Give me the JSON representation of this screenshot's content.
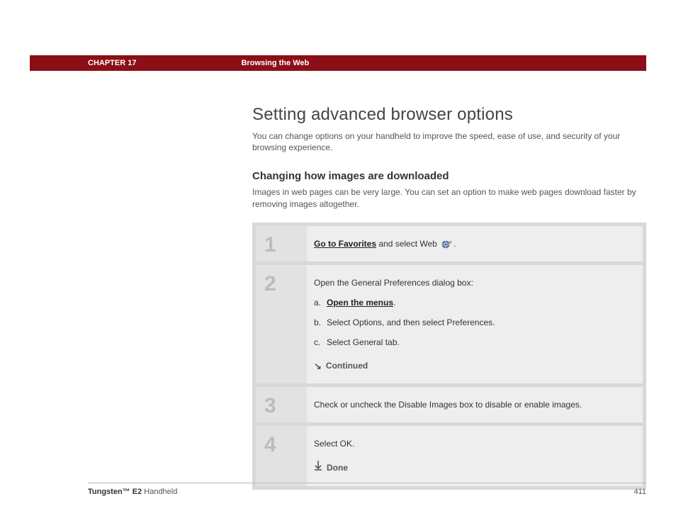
{
  "header": {
    "chapter": "CHAPTER 17",
    "title": "Browsing the Web"
  },
  "main": {
    "h1": "Setting advanced browser options",
    "intro": "You can change options on your handheld to improve the speed, ease of use, and security of your browsing experience.",
    "h2": "Changing how images are downloaded",
    "sub_intro": "Images in web pages can be very large. You can set an option to make web pages download faster by removing images altogether."
  },
  "steps": [
    {
      "num": "1",
      "link_text": "Go to Favorites",
      "after_link": " and select Web ",
      "trailing": "."
    },
    {
      "num": "2",
      "lead": "Open the General Preferences dialog box:",
      "substeps": [
        {
          "label": "a.",
          "link": "Open the menus",
          "tail": "."
        },
        {
          "label": "b.",
          "text": "Select Options, and then select Preferences."
        },
        {
          "label": "c.",
          "text": "Select General tab."
        }
      ],
      "continued": "Continued"
    },
    {
      "num": "3",
      "text": "Check or uncheck the Disable Images box to disable or enable images."
    },
    {
      "num": "4",
      "text": "Select OK.",
      "done": "Done"
    }
  ],
  "footer": {
    "product_bold": "Tungsten™ E2",
    "product_rest": " Handheld",
    "page": "411"
  }
}
